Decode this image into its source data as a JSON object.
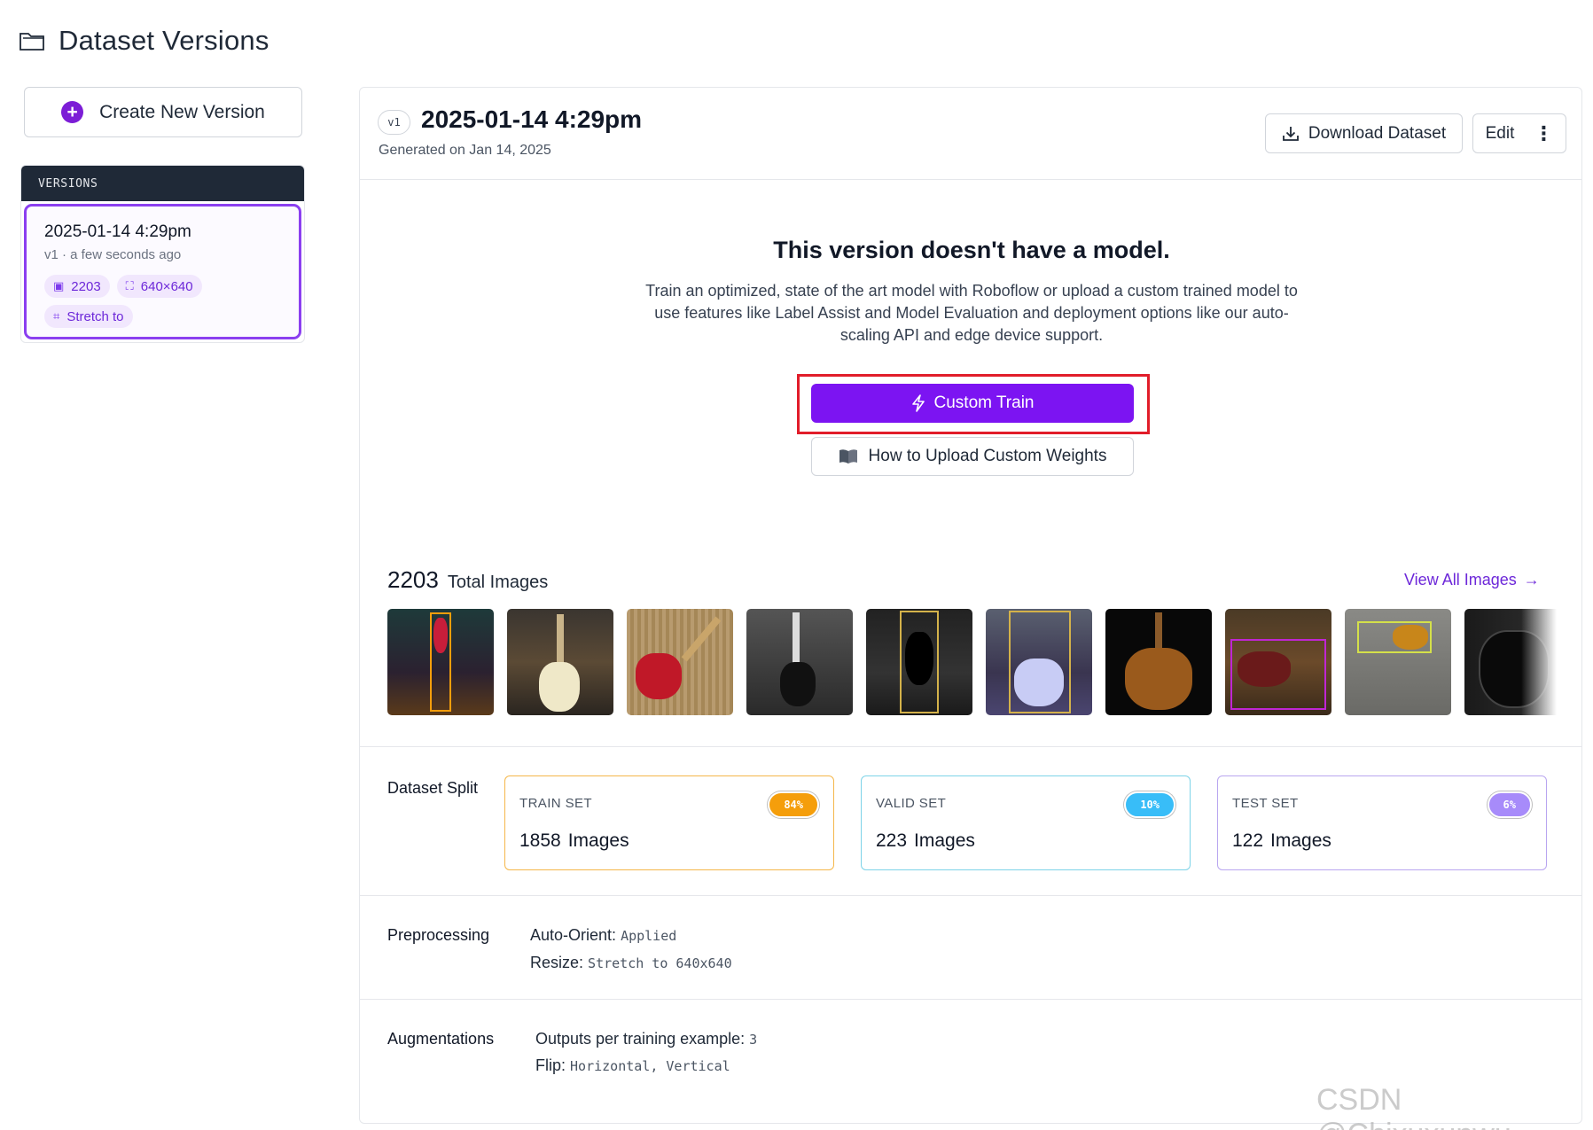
{
  "header": {
    "title": "Dataset Versions",
    "icon": "folder-icon"
  },
  "sidebar": {
    "create_button": "Create New Version",
    "versions_heading": "VERSIONS",
    "version": {
      "title": "2025-01-14 4:29pm",
      "subtitle": "v1 · a few seconds ago",
      "chips": {
        "images": "2203",
        "size": "640×640",
        "resize": "Stretch to"
      }
    }
  },
  "main": {
    "badge": "v1",
    "title": "2025-01-14 4:29pm",
    "subtitle": "Generated on Jan 14, 2025",
    "download_label": "Download Dataset",
    "edit_label": "Edit",
    "no_model": {
      "title": "This version doesn't have a model.",
      "description": "Train an optimized, state of the art model with Roboflow or upload a custom trained model to use features like Label Assist and Model Evaluation and deployment options like our auto-scaling API and edge device support.",
      "train_label": "Custom Train",
      "upload_label": "How to Upload Custom Weights"
    },
    "images": {
      "total": "2203",
      "label": "Total Images",
      "view_all": "View All Images"
    },
    "split": {
      "label": "Dataset Split",
      "sets": [
        {
          "name": "TRAIN SET",
          "percent": "84%",
          "count": "1858",
          "unit": "Images",
          "color": "#f59e0b"
        },
        {
          "name": "VALID SET",
          "percent": "10%",
          "count": "223",
          "unit": "Images",
          "color": "#38bdf8"
        },
        {
          "name": "TEST SET",
          "percent": "6%",
          "count": "122",
          "unit": "Images",
          "color": "#a78bfa"
        }
      ]
    },
    "preprocessing": {
      "label": "Preprocessing",
      "items": [
        {
          "key": "Auto-Orient:",
          "value": "Applied"
        },
        {
          "key": "Resize:",
          "value": "Stretch to 640x640"
        }
      ]
    },
    "augmentations": {
      "label": "Augmentations",
      "items": [
        {
          "key": "Outputs per training example:",
          "value": "3"
        },
        {
          "key": "Flip:",
          "value": "Horizontal, Vertical"
        }
      ]
    }
  },
  "watermark": "CSDN @Chixuxunwu"
}
